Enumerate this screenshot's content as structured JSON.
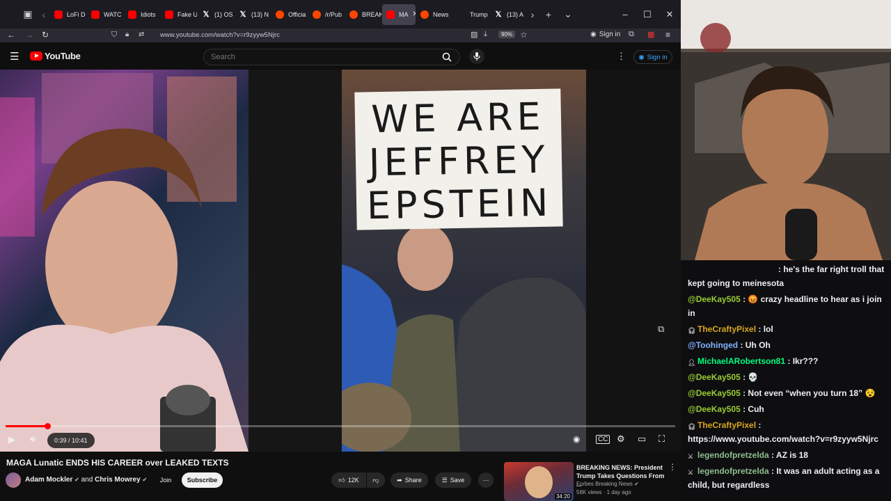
{
  "browser": {
    "tabs": [
      {
        "label": "LoFi D",
        "icon": "youtube-icon"
      },
      {
        "label": "WATC",
        "icon": "youtube-icon"
      },
      {
        "label": "Idiots",
        "icon": "youtube-icon"
      },
      {
        "label": "Fake U",
        "icon": "youtube-icon"
      },
      {
        "label": "(1) OS",
        "icon": "x-icon"
      },
      {
        "label": "(13) N",
        "icon": "x-icon"
      },
      {
        "label": "Officia",
        "icon": "reddit-icon"
      },
      {
        "label": "/r/Pub",
        "icon": "reddit-icon"
      },
      {
        "label": "BREAK",
        "icon": "reddit-icon"
      },
      {
        "label": "MA",
        "icon": "youtube-icon",
        "active": true
      },
      {
        "label": "News",
        "icon": "reddit-icon"
      },
      {
        "label": "Trump",
        "icon": "blank-icon"
      },
      {
        "label": "(13) A",
        "icon": "x-icon"
      }
    ],
    "url": "www.youtube.com/watch?v=r9zyyw5Njrc",
    "zoom": "90%",
    "signin_label": "Sign in"
  },
  "youtube": {
    "logo_text": "YouTube",
    "search_placeholder": "Search",
    "signin_label": "Sign in",
    "video": {
      "sign_lines": [
        "WE ARE",
        "JEFFREY",
        "EPSTEIN"
      ],
      "time": "0:39 / 10:41",
      "progress": 0.062,
      "title": "MAGA Lunatic ENDS HIS CAREER over LEAKED TEXTS",
      "channel": "Adam Mockler",
      "collab_and": "and",
      "collab": "Chris Mowrey",
      "join_label": "Join",
      "subscribe_label": "Subscribe",
      "likes": "12K",
      "share_label": "Share",
      "save_label": "Save"
    },
    "recommended": {
      "title": "BREAKING NEWS: President Trump Takes Questions From ...",
      "channel": "Forbes Breaking News",
      "meta": "56K views · 1 day ago",
      "duration": "34:20"
    }
  },
  "chat": [
    {
      "user": "",
      "text": ": he's the far right troll that kept going to meinesota",
      "color": "#efeff1",
      "badge": "none"
    },
    {
      "user": "@DeeKay505",
      "text": " : 😡 crazy headline to hear as i join in",
      "color": "#9acd32",
      "badge": "none"
    },
    {
      "user": "TheCraftyPixel",
      "text": " : lol",
      "color": "#daa520",
      "badge": "headset-badge"
    },
    {
      "user": "@Toohinged",
      "text": " : Uh Oh",
      "color": "#7fb3ff",
      "badge": "none"
    },
    {
      "user": "MichaelARobertson81",
      "text": " : Ikr???",
      "color": "#00ff7f",
      "badge": "person-badge"
    },
    {
      "user": "@DeeKay505",
      "text": " : 💀",
      "color": "#9acd32",
      "badge": "none"
    },
    {
      "user": "@DeeKay505",
      "text": " : Not even “when you turn 18” 😵",
      "color": "#9acd32",
      "badge": "none"
    },
    {
      "user": "@DeeKay505",
      "text": " : Cuh",
      "color": "#9acd32",
      "badge": "none"
    },
    {
      "user": "TheCraftyPixel",
      "text": " : https://www.youtube.com/watch?v=r9zyyw5Njrc",
      "color": "#daa520",
      "badge": "headset-badge"
    },
    {
      "user": "legendofpretzelda",
      "text": " : AZ is 18",
      "color": "#8fbc8f",
      "badge": "sword-badge"
    },
    {
      "user": "legendofpretzelda",
      "text": " : It was an adult acting as a child, but regardless",
      "color": "#8fbc8f",
      "badge": "sword-badge"
    }
  ]
}
